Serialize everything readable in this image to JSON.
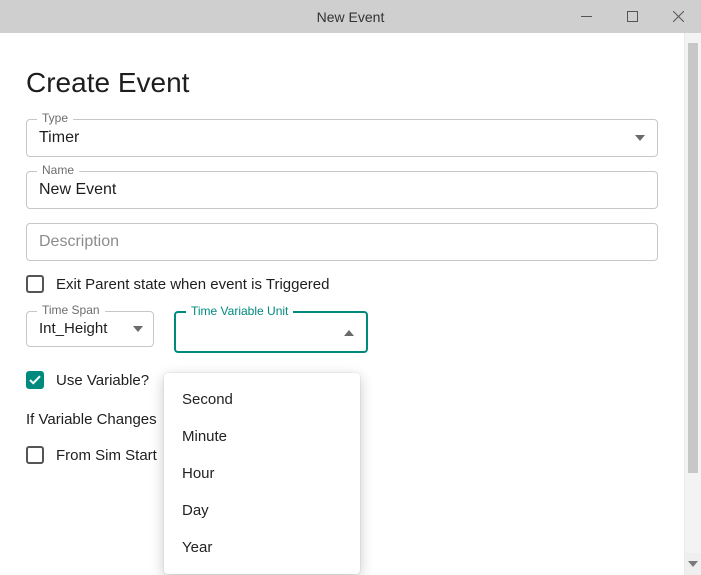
{
  "window": {
    "title": "New Event"
  },
  "page": {
    "heading": "Create Event"
  },
  "fields": {
    "type": {
      "label": "Type",
      "value": "Timer"
    },
    "name": {
      "label": "Name",
      "value": "New Event"
    },
    "description": {
      "placeholder": "Description"
    },
    "time_span": {
      "label": "Time Span",
      "value": "Int_Height"
    },
    "time_unit": {
      "label": "Time Variable Unit",
      "value": ""
    }
  },
  "checkboxes": {
    "exit_parent": {
      "label": "Exit Parent state when event is Triggered",
      "checked": false
    },
    "use_variable": {
      "label": "Use Variable?",
      "checked": true
    },
    "from_sim_start": {
      "label": "From Sim Start",
      "checked": false
    }
  },
  "section": {
    "if_variable_changes": "If Variable Changes"
  },
  "time_unit_options": [
    "Second",
    "Minute",
    "Hour",
    "Day",
    "Year"
  ],
  "colors": {
    "accent": "#008a7e"
  }
}
